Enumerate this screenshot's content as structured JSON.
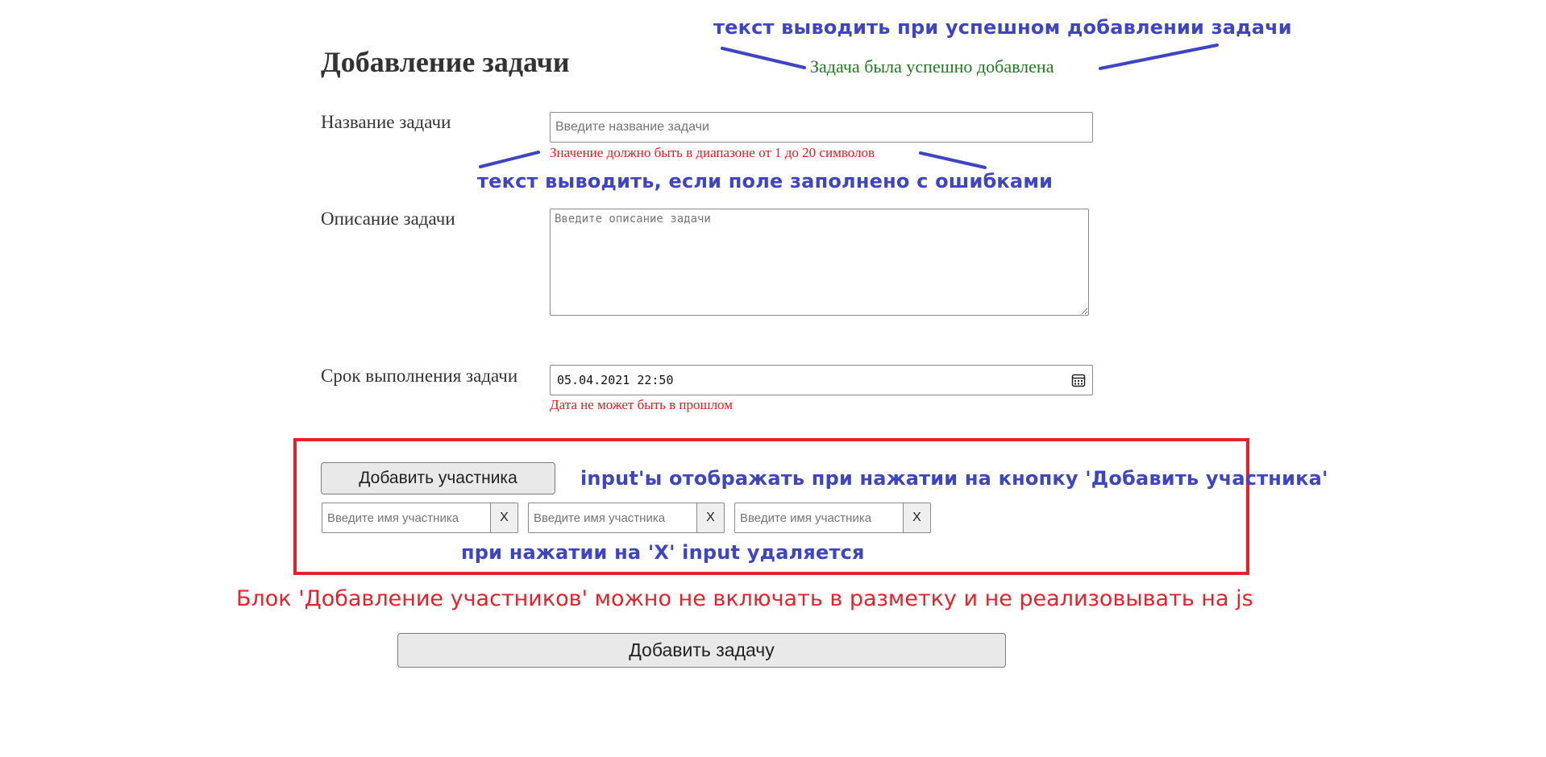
{
  "form": {
    "title": "Добавление задачи",
    "success_message": "Задача была успешно добавлена",
    "name_label": "Название задачи",
    "name_placeholder": "Введите название задачи",
    "name_error": "Значение должно быть в диапазоне от 1 до 20 символов",
    "description_label": "Описание задачи",
    "description_placeholder": "Введите описание задачи",
    "deadline_label": "Срок выполнения задачи",
    "deadline_value": "05.04.2021 22:50",
    "deadline_error": "Дата не может быть в прошлом",
    "calendar_icon": "calendar-icon",
    "add_participant_label": "Добавить участника",
    "participants": [
      {
        "placeholder": "Введите имя участника",
        "remove_label": "X"
      },
      {
        "placeholder": "Введите имя участника",
        "remove_label": "X"
      },
      {
        "placeholder": "Введите имя участника",
        "remove_label": "X"
      }
    ],
    "submit_label": "Добавить задачу"
  },
  "annotations": {
    "success_note": "текст выводить при успешном добавлении задачи",
    "error_note": "текст выводить, если поле заполнено с ошибками",
    "participants_note": "input'ы отображать при нажатии на кнопку 'Добавить участника'",
    "remove_note": "при нажатии на 'X' input удаляется",
    "block_note": "Блок 'Добавление участников' можно не включать в разметку и не реализовывать  на js"
  },
  "colors": {
    "annotation_blue": "#3d45c4",
    "error_red": "#e51c1c",
    "success_green": "#1f7a1f",
    "highlight_red": "#e8202a"
  }
}
